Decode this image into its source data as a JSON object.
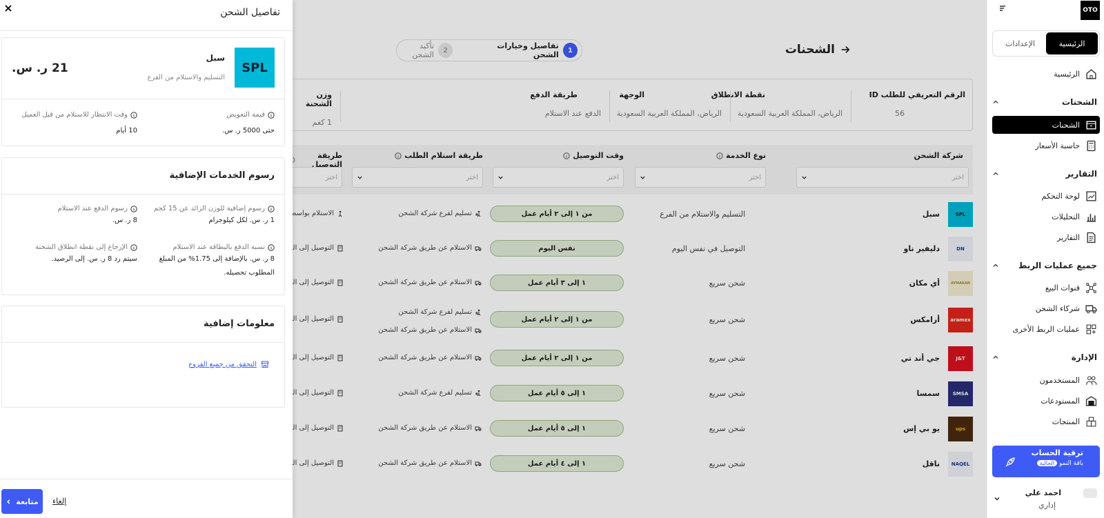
{
  "sidebar": {
    "logo": "OTO",
    "tabs": [
      "الرئيسية",
      "الإعدادات"
    ],
    "home": "الرئيسية",
    "sections": {
      "shipments": {
        "title": "الشحنات",
        "items": [
          "الشحنات",
          "حاسبة الأسعار"
        ]
      },
      "reports": {
        "title": "التقارير",
        "items": [
          "لوحة التحكم",
          "التحليلات",
          "التقارير"
        ]
      },
      "integrations": {
        "title": "جميع عمليات الربط",
        "items": [
          "قنوات البيع",
          "شركاء الشحن",
          "عمليات الربط الأخرى"
        ]
      },
      "admin": {
        "title": "الإدارة",
        "items": [
          "المستخدمون",
          "المستودعات",
          "المنتجات"
        ]
      }
    },
    "upgrade": {
      "title": "ترقية الحساب",
      "plan": "باقة النمو",
      "badge": "الحالية"
    },
    "user": {
      "name": "احمد علي",
      "role": "إداري"
    }
  },
  "page": {
    "title": "الشحنات",
    "steps": [
      {
        "num": "1",
        "label": "تفاصيل وخيارات الشحن"
      },
      {
        "num": "2",
        "label": "تأكيد الشحن"
      }
    ],
    "info": {
      "order_id_label": "الرقم التعريفي للطلب ID",
      "order_id": "56",
      "origin_label": "نقطة الانطلاق",
      "origin": "الرياض، المملكة العربية السعودية",
      "dest_label": "الوجهة",
      "dest": "الرياض، المملكة العربية السعودية",
      "payment_label": "طريقة الدفع",
      "payment": "الدفع عند الاستلام",
      "weight_label": "وزن الشحنة",
      "weight": "1 كغم"
    },
    "columns": {
      "carrier": "شركة الشحن",
      "service": "نوع الخدمة",
      "time": "وقت التوصيل",
      "pickup": "طريقة استلام الطلب",
      "delivery": "طريقة التوصيل",
      "placeholder": "اختر"
    },
    "rows": [
      {
        "name": "سبل",
        "logo": "SPL",
        "service": "التسليم والاستلام من الفرع",
        "time": "من ١ إلى ٢ أيام عمل",
        "pickup": "تسليم لفرع شركة الشحن",
        "delivery": "الاستلام بواسطة"
      },
      {
        "name": "دليفير ناو",
        "logo": "DN",
        "service": "التوصيل في نفس اليوم",
        "time": "نفس اليوم",
        "pickup": "الاستلام عن طريق شركة الشحن",
        "delivery": "التوصيل إلى العنوان"
      },
      {
        "name": "أي مكان",
        "logo": "AYMAKAN",
        "service": "شحن سريع",
        "time": "١ إلى ٣ أيام عمل",
        "pickup": "الاستلام عن طريق شركة الشحن",
        "delivery": "التوصيل إلى العنوان"
      },
      {
        "name": "أرامكس",
        "logo": "aramex",
        "service": "شحن سريع",
        "time": "من ١ إلى ٢ أيام عمل",
        "pickup": "تسليم لفرع شركة الشحن",
        "pickup2": "الاستلام عن طريق شركة الشحن",
        "delivery": "التوصيل إلى العنوان"
      },
      {
        "name": "جي أند تي",
        "logo": "J&T",
        "service": "شحن سريع",
        "time": "من ١ إلى ٢ أيام عمل",
        "pickup": "الاستلام عن طريق شركة الشحن",
        "delivery": "التوصيل إلى العنوان"
      },
      {
        "name": "سمسا",
        "logo": "SMSA",
        "service": "شحن سريع",
        "time": "١ إلى ٥ أيام عمل",
        "pickup": "تسليم لفرع شركة الشحن",
        "delivery": "التوصيل إلى العنوان"
      },
      {
        "name": "يو بي إس",
        "logo": "ups",
        "service": "شحن سريع",
        "time": "١ إلى ٥ أيام عمل",
        "pickup": "الاستلام عن طريق شركة الشحن",
        "delivery": "التوصيل إلى العنوان"
      },
      {
        "name": "ناقل",
        "logo": "NAQEL",
        "service": "شحن سريع",
        "time": "١ إلى ٤ أيام عمل",
        "pickup": "الاستلام عن طريق شركة الشحن",
        "delivery": "التوصيل إلى العنوان"
      }
    ]
  },
  "drawer": {
    "title": "تفاصيل الشحن",
    "carrier": {
      "name": "سبل",
      "logo": "SPL",
      "service": "التسليم والاستلام من الفرع",
      "price": "21 ر. س."
    },
    "compensation_label": "قيمة التعويض",
    "compensation": "حتى 5000 ر. س.",
    "wait_label": "وقت الانتظار للاستلام من قبل العميل",
    "wait": "10 أيام",
    "fees_title": "رسوم الخدمات الإضافية",
    "extra_weight_label": "رسوم إضافية للوزن الزائد عن 15 كجم",
    "extra_weight": "1 ر. س. لكل كيلوجرام",
    "cod_fee_label": "رسوم الدفع عند الاستلام",
    "cod_fee": "8 ر. س.",
    "card_pct_label": "نسبة الدفع بالبطاقة عند الاستلام",
    "card_pct": "8 ر. س. بالإضافة إلى 1.75% من المبلغ المطلوب تحصيله.",
    "return_label": "الإرجاع إلى نقطة انطلاق الشحنة",
    "return": "سيتم رد 8 ر. س. إلى الرصيد.",
    "more_title": "معلومات إضافية",
    "branches_link": "التحقق من جميع الفروع",
    "continue": "متابعة",
    "cancel": "إلغاء"
  },
  "colors": {
    "accent": "#3f5bf6",
    "time_badge_bg": "#e2ecd7",
    "time_badge_border": "#9fc18b",
    "active_nav": "#000000"
  }
}
